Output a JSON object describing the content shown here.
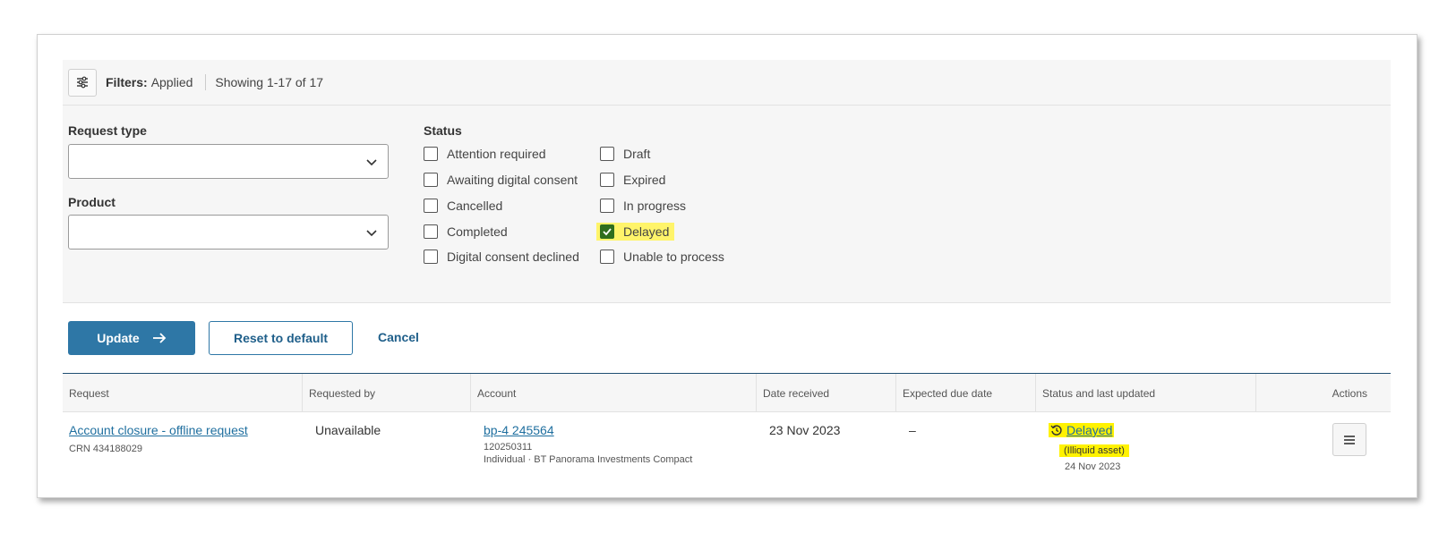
{
  "filterbar": {
    "label": "Filters:",
    "value": "Applied",
    "showing": "Showing 1-17 of 17"
  },
  "filters": {
    "request_type_label": "Request type",
    "product_label": "Product",
    "status_label": "Status",
    "status_col1": [
      {
        "label": "Attention required",
        "checked": false
      },
      {
        "label": "Awaiting digital consent",
        "checked": false
      },
      {
        "label": "Cancelled",
        "checked": false
      },
      {
        "label": "Completed",
        "checked": false
      },
      {
        "label": "Digital consent declined",
        "checked": false
      }
    ],
    "status_col2": [
      {
        "label": "Draft",
        "checked": false
      },
      {
        "label": "Expired",
        "checked": false
      },
      {
        "label": "In progress",
        "checked": false
      },
      {
        "label": "Delayed",
        "checked": true
      },
      {
        "label": "Unable to process",
        "checked": false
      }
    ]
  },
  "buttons": {
    "update": "Update",
    "reset": "Reset to default",
    "cancel": "Cancel"
  },
  "table": {
    "headers": [
      "Request",
      "Requested by",
      "Account",
      "Date received",
      "Expected due date",
      "Status and last updated",
      "Actions"
    ],
    "rows": [
      {
        "request": "Account closure - offline request",
        "crn": "CRN 434188029",
        "requested_by": "Unavailable",
        "account_link": "bp-4 245564",
        "account_number": "120250311",
        "account_desc": "Individual · BT Panorama Investments Compact",
        "date_received": "23 Nov 2023",
        "expected_due": "–",
        "status": "Delayed",
        "status_note": "(Illiquid asset)",
        "last_updated": "24 Nov 2023"
      }
    ]
  },
  "colors": {
    "accent": "#2e77a6",
    "highlight": "#fff200",
    "checked": "#2f6e1e"
  }
}
